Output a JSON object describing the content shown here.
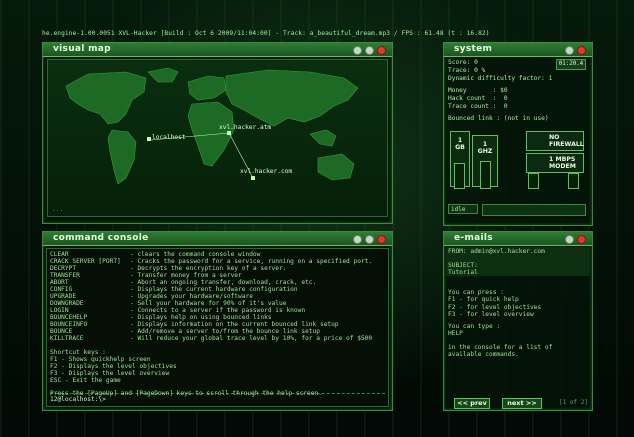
{
  "topbar": {
    "text": "he.engine-1.00.0051 XVL-Hacker [Build : Oct  6 2009/11:04:00] - Track: a_beautiful_dream.mp3 / FPS : 61.48 (t : 16.82)"
  },
  "map": {
    "title": "visual map",
    "hosts": [
      {
        "name": "localhost"
      },
      {
        "name": "xvl.hacker.atm"
      },
      {
        "name": "xvl.hacker.com"
      }
    ],
    "footer": "..."
  },
  "system": {
    "title": "system",
    "timer": "01:20.4",
    "score": "Score: 0",
    "trace": "Trace: 0 %",
    "difficulty": "Dynamic difficulty factor: 1",
    "money": "Money       : $0",
    "hack_count": "Hack count  :  0",
    "trace_count": "Trace count :  0",
    "bounced": "Bounced link : (not in use)",
    "hw_memory": "1\nGB",
    "hw_cpu": "1\nGHZ",
    "hw_firewall": "NO\nFIREWALL",
    "hw_modem": "1 MBPS\nMODEM",
    "status": "idle"
  },
  "console": {
    "title": "command console",
    "commands": [
      {
        "cmd": "CLEAR",
        "desc": "- clears the command console window"
      },
      {
        "cmd": "CRACK SERVER [PORT]",
        "desc": "- Cracks the password for a service, running on a specified port."
      },
      {
        "cmd": "DECRYPT",
        "desc": "- Decrypts the encryption key of a server."
      },
      {
        "cmd": "TRANSFER",
        "desc": "- Transfer money from a server"
      },
      {
        "cmd": "ABORT",
        "desc": "- Abort an ongoing transfer, download, crack, etc."
      },
      {
        "cmd": "CONFIG",
        "desc": "- Displays the current hardware configuration"
      },
      {
        "cmd": "UPGRADE",
        "desc": "- Upgrades your hardware/software"
      },
      {
        "cmd": "DOWNGRADE",
        "desc": "- Sell your hardware for 90% of it's value"
      },
      {
        "cmd": "LOGIN",
        "desc": "- Connects to a server if the password is known"
      },
      {
        "cmd": "BOUNCEHELP",
        "desc": "- Displays help on using bounced links"
      },
      {
        "cmd": "BOUNCEINFO",
        "desc": "- Displays information on the current bounced link setup"
      },
      {
        "cmd": "BOUNCE",
        "desc": "- Add/remove a server to/from the bounce link setup"
      },
      {
        "cmd": "KILLTRACE",
        "desc": "- Will reduce your global trace level by 10%, for a price of $500"
      }
    ],
    "shortcuts_title": "Shortcut keys :",
    "shortcuts": [
      "F1  - Shows quickhelp screen",
      "F2  - Displays the level objectives",
      "F3  - Displays the level overview",
      "ESC - Exit the game"
    ],
    "scroll_hint": "Press the [PageUp] and [PageDown] keys to scroll through the help screen.",
    "prompt": "12@localhost:\\>"
  },
  "emails": {
    "title": "e-mails",
    "from": "FROM: admin@xvl.hacker.com",
    "subject": "SUBJECT:\nTutorial",
    "body1": "You can press :\nF1 - for quick help\nF2 - for level objectives\nF3 - for level overview",
    "body2": "You can type :\nHELP",
    "body3": "in the console for a list of\navailable commands.",
    "prev": "<< prev",
    "next": "next >>",
    "pager": "[1 of 2]"
  },
  "colors": {
    "accent": "#3c8a3e",
    "text": "#9ce696",
    "close": "#e23a2a"
  }
}
